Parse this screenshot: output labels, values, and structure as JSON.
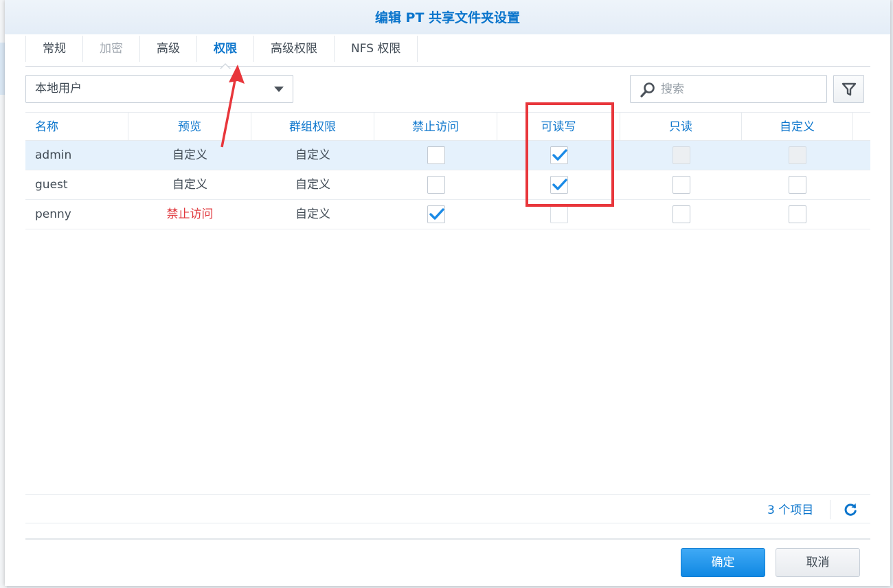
{
  "dialog": {
    "title": "编辑 PT 共享文件夹设置"
  },
  "tabs": [
    {
      "label": "常规",
      "state": "normal"
    },
    {
      "label": "加密",
      "state": "disabled"
    },
    {
      "label": "高级",
      "state": "normal"
    },
    {
      "label": "权限",
      "state": "active"
    },
    {
      "label": "高级权限",
      "state": "normal"
    },
    {
      "label": "NFS 权限",
      "state": "normal"
    }
  ],
  "user_type_select": {
    "value": "本地用户"
  },
  "search": {
    "placeholder": "搜索",
    "value": ""
  },
  "table": {
    "columns": [
      "名称",
      "预览",
      "群组权限",
      "禁止访问",
      "可读写",
      "只读",
      "自定义"
    ],
    "rows": [
      {
        "name": "admin",
        "preview": "自定义",
        "group": "自定义",
        "deny": "unchecked",
        "rw": "checked",
        "ro": "disabled",
        "custom": "disabled",
        "selected": true
      },
      {
        "name": "guest",
        "preview": "自定义",
        "group": "自定义",
        "deny": "unchecked",
        "rw": "checked",
        "ro": "unchecked",
        "custom": "unchecked",
        "selected": false
      },
      {
        "name": "penny",
        "preview": "禁止访问",
        "group": "自定义",
        "deny": "checked",
        "rw": "unchecked-faint",
        "ro": "unchecked",
        "custom": "unchecked",
        "selected": false
      }
    ]
  },
  "footer": {
    "count_label": "3 个项目"
  },
  "buttons": {
    "ok": "确定",
    "cancel": "取消"
  },
  "colors": {
    "accent": "#0b75cc",
    "danger": "#e0393e",
    "annotation": "#e8363b",
    "primary_button": "#1d93ea"
  },
  "icons": {
    "search": "magnifier-icon",
    "filter": "funnel-icon",
    "refresh": "refresh-icon",
    "check": "checkmark-icon"
  }
}
